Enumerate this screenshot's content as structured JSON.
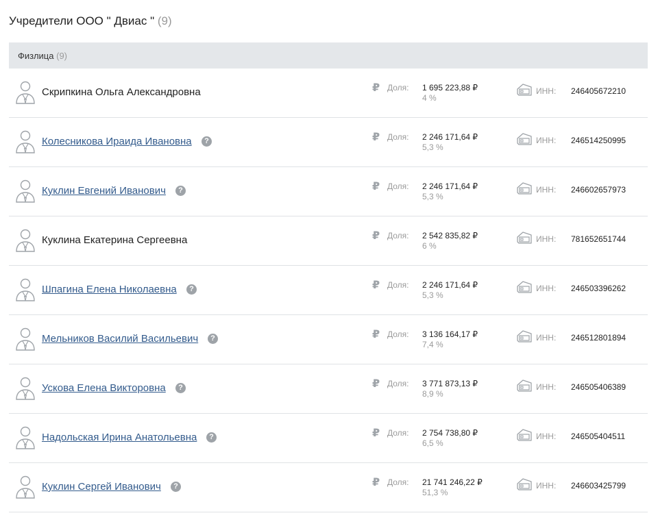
{
  "header": {
    "title": "Учредители ООО \" Двиас \"",
    "count": "(9)"
  },
  "group": {
    "label": "Физлица",
    "count": "(9)"
  },
  "labels": {
    "share": "Доля:",
    "inn": "ИНН:",
    "help": "?",
    "ruble": "₽"
  },
  "colors": {
    "link": "#335b8c",
    "muted": "#9a9a9a",
    "icon": "#9ea3a8",
    "header_bg": "#e4e7ea"
  },
  "icons": {
    "person": "person-icon",
    "ruble": "ruble-icon",
    "card": "card-icon",
    "help": "help-icon"
  },
  "founders": [
    {
      "name": "Скрипкина Ольга Александровна",
      "link": false,
      "amount": "1 695 223,88 ₽",
      "percent": "4 %",
      "inn": "246405672210"
    },
    {
      "name": "Колесникова Ираида Ивановна",
      "link": true,
      "amount": "2 246 171,64 ₽",
      "percent": "5,3 %",
      "inn": "246514250995"
    },
    {
      "name": "Куклин Евгений Иванович",
      "link": true,
      "amount": "2 246 171,64 ₽",
      "percent": "5,3 %",
      "inn": "246602657973"
    },
    {
      "name": "Куклина Екатерина Сергеевна",
      "link": false,
      "amount": "2 542 835,82 ₽",
      "percent": "6 %",
      "inn": "781652651744"
    },
    {
      "name": "Шпагина Елена Николаевна",
      "link": true,
      "amount": "2 246 171,64 ₽",
      "percent": "5,3 %",
      "inn": "246503396262"
    },
    {
      "name": "Мельников Василий Васильевич",
      "link": true,
      "amount": "3 136 164,17 ₽",
      "percent": "7,4 %",
      "inn": "246512801894"
    },
    {
      "name": "Ускова Елена Викторовна",
      "link": true,
      "amount": "3 771 873,13 ₽",
      "percent": "8,9 %",
      "inn": "246505406389"
    },
    {
      "name": "Надольская Ирина Анатольевна",
      "link": true,
      "amount": "2 754 738,80 ₽",
      "percent": "6,5 %",
      "inn": "246505404511"
    },
    {
      "name": "Куклин Сергей Иванович",
      "link": true,
      "amount": "21 741 246,22 ₽",
      "percent": "51,3 %",
      "inn": "246603425799"
    }
  ]
}
